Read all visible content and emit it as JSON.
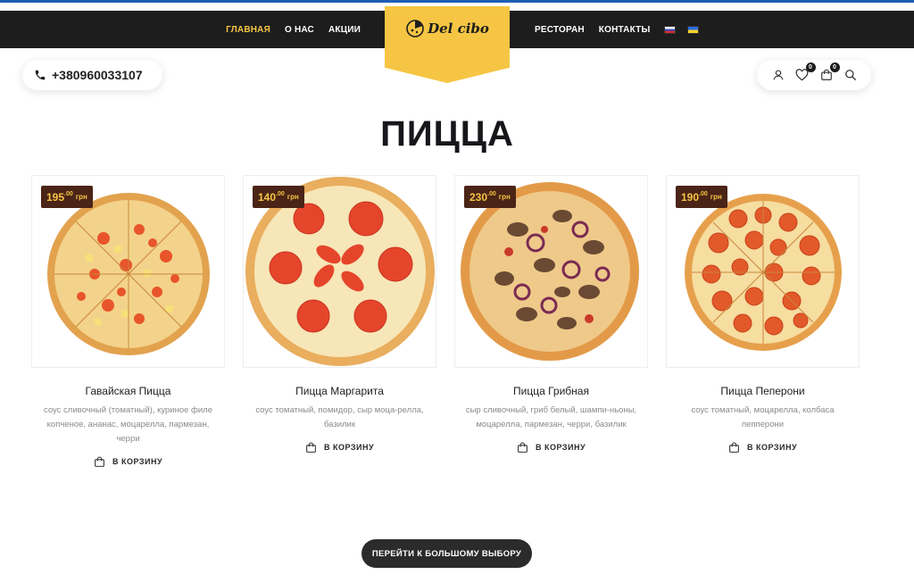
{
  "nav": {
    "left": [
      "ГЛАВНАЯ",
      "О НАС",
      "АКЦИИ"
    ],
    "right": [
      "РЕСТОРАН",
      "КОНТАКТЫ"
    ],
    "active_index": 0
  },
  "logo": {
    "text": "Del cibo"
  },
  "header": {
    "phone": "+380960033107",
    "wishlist_count": "0",
    "cart_count": "0"
  },
  "page": {
    "title": "ПИЦЦА"
  },
  "products": [
    {
      "name": "Гавайская Пицца",
      "desc": "соус сливочный (томатный), куриное филе копченое, ананас, моцарелла, пармезан, черри",
      "price_int": "195",
      "price_cents": ".00",
      "currency": "грн",
      "cart_label": "В КОРЗИНУ",
      "style": "hawaiian"
    },
    {
      "name": "Пицца Маргарита",
      "desc": "соус томатный, помидор, сыр моца-релла, базилик",
      "price_int": "140",
      "price_cents": ".00",
      "currency": "грн",
      "cart_label": "В КОРЗИНУ",
      "style": "margarita"
    },
    {
      "name": "Пицца Грибная",
      "desc": "сыр сливочный, гриб белый, шампи-ньоны, моцарелла, пармезан, черри, базилик",
      "price_int": "230",
      "price_cents": ".00",
      "currency": "грн",
      "cart_label": "В КОРЗИНУ",
      "style": "mushroom"
    },
    {
      "name": "Пицца Пеперони",
      "desc": "соус томатный, моцарелла, колбаса пепперони",
      "price_int": "190",
      "price_cents": ".00",
      "currency": "грн",
      "cart_label": "В КОРЗИНУ",
      "style": "pepperoni"
    }
  ],
  "cta": {
    "label": "ПЕРЕЙТИ К БОЛЬШОМУ ВЫБОРУ"
  },
  "colors": {
    "accent": "#f6c544",
    "nav_bg": "#1d1d1d",
    "price_bg": "#4a2416",
    "top_line": "#1e5fb4"
  }
}
